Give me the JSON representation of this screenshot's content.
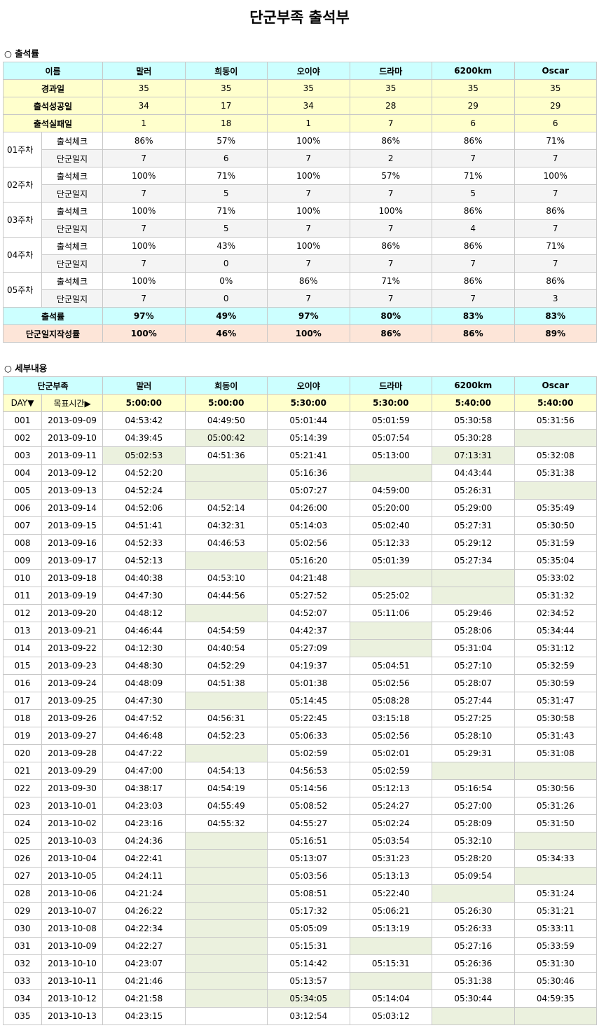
{
  "title": "단군부족 출석부",
  "section1": "○ 출석률",
  "section2": "○ 세부내용",
  "members": [
    "말러",
    "희동이",
    "오이야",
    "드라마",
    "6200km",
    "Oscar"
  ],
  "summary": {
    "header_label": "이름",
    "rows": [
      {
        "label": "경과일",
        "values": [
          "35",
          "35",
          "35",
          "35",
          "35",
          "35"
        ]
      },
      {
        "label": "출석성공일",
        "values": [
          "34",
          "17",
          "34",
          "28",
          "29",
          "29"
        ]
      },
      {
        "label": "출석실패일",
        "values": [
          "1",
          "18",
          "1",
          "7",
          "6",
          "6"
        ]
      }
    ],
    "check_label": "출석체크",
    "log_label": "단군일지",
    "weeks": [
      {
        "label": "01주차",
        "check": [
          "86%",
          "57%",
          "100%",
          "86%",
          "86%",
          "71%"
        ],
        "log": [
          "7",
          "6",
          "7",
          "2",
          "7",
          "7"
        ]
      },
      {
        "label": "02주차",
        "check": [
          "100%",
          "71%",
          "100%",
          "57%",
          "71%",
          "100%"
        ],
        "log": [
          "7",
          "5",
          "7",
          "7",
          "5",
          "7"
        ]
      },
      {
        "label": "03주차",
        "check": [
          "100%",
          "71%",
          "100%",
          "100%",
          "86%",
          "86%"
        ],
        "log": [
          "7",
          "5",
          "7",
          "7",
          "4",
          "7"
        ]
      },
      {
        "label": "04주차",
        "check": [
          "100%",
          "43%",
          "100%",
          "86%",
          "86%",
          "71%"
        ],
        "log": [
          "7",
          "0",
          "7",
          "7",
          "7",
          "7"
        ]
      },
      {
        "label": "05주차",
        "check": [
          "100%",
          "0%",
          "86%",
          "71%",
          "86%",
          "86%"
        ],
        "log": [
          "7",
          "0",
          "7",
          "7",
          "7",
          "3"
        ]
      }
    ],
    "rate": {
      "label": "출석률",
      "values": [
        "97%",
        "49%",
        "97%",
        "80%",
        "83%",
        "83%"
      ]
    },
    "log_rate": {
      "label": "단군일지작성률",
      "values": [
        "100%",
        "46%",
        "100%",
        "86%",
        "86%",
        "89%"
      ]
    }
  },
  "detail": {
    "header_label": "단군부족",
    "day_label": "DAY▼",
    "target_label": "목표시간▶",
    "targets": [
      "5:00:00",
      "5:00:00",
      "5:30:00",
      "5:30:00",
      "5:40:00",
      "5:40:00"
    ],
    "highlight_color": "#ebf1de",
    "rows": [
      {
        "day": "001",
        "date": "2013-09-09",
        "times": [
          "04:53:42",
          "04:49:50",
          "05:01:44",
          "05:01:59",
          "05:30:58",
          "05:31:56"
        ],
        "miss": []
      },
      {
        "day": "002",
        "date": "2013-09-10",
        "times": [
          "04:39:45",
          "05:00:42",
          "05:14:39",
          "05:07:54",
          "05:30:28",
          ""
        ],
        "miss": [
          1,
          5
        ]
      },
      {
        "day": "003",
        "date": "2013-09-11",
        "times": [
          "05:02:53",
          "04:51:36",
          "05:21:41",
          "05:13:00",
          "07:13:31",
          "05:32:08"
        ],
        "miss": [
          0,
          4
        ]
      },
      {
        "day": "004",
        "date": "2013-09-12",
        "times": [
          "04:52:20",
          "",
          "05:16:36",
          "",
          "04:43:44",
          "05:31:38"
        ],
        "miss": [
          1,
          3
        ]
      },
      {
        "day": "005",
        "date": "2013-09-13",
        "times": [
          "04:52:24",
          "",
          "05:07:27",
          "04:59:00",
          "05:26:31",
          ""
        ],
        "miss": [
          1,
          5
        ]
      },
      {
        "day": "006",
        "date": "2013-09-14",
        "times": [
          "04:52:06",
          "04:52:14",
          "04:26:00",
          "05:20:00",
          "05:29:00",
          "05:35:49"
        ],
        "miss": []
      },
      {
        "day": "007",
        "date": "2013-09-15",
        "times": [
          "04:51:41",
          "04:32:31",
          "05:14:03",
          "05:02:40",
          "05:27:31",
          "05:30:50"
        ],
        "miss": []
      },
      {
        "day": "008",
        "date": "2013-09-16",
        "times": [
          "04:52:33",
          "04:46:53",
          "05:02:56",
          "05:12:33",
          "05:29:12",
          "05:31:59"
        ],
        "miss": []
      },
      {
        "day": "009",
        "date": "2013-09-17",
        "times": [
          "04:52:13",
          "",
          "05:16:20",
          "05:01:39",
          "05:27:34",
          "05:35:04"
        ],
        "miss": [
          1
        ]
      },
      {
        "day": "010",
        "date": "2013-09-18",
        "times": [
          "04:40:38",
          "04:53:10",
          "04:21:48",
          "",
          "",
          "05:33:02"
        ],
        "miss": [
          3,
          4
        ]
      },
      {
        "day": "011",
        "date": "2013-09-19",
        "times": [
          "04:47:30",
          "04:44:56",
          "05:27:52",
          "05:25:02",
          "",
          "05:31:32"
        ],
        "miss": [
          4
        ]
      },
      {
        "day": "012",
        "date": "2013-09-20",
        "times": [
          "04:48:12",
          "",
          "04:52:07",
          "05:11:06",
          "05:29:46",
          "02:34:52"
        ],
        "miss": [
          1
        ]
      },
      {
        "day": "013",
        "date": "2013-09-21",
        "times": [
          "04:46:44",
          "04:54:59",
          "04:42:37",
          "",
          "05:28:06",
          "05:34:44"
        ],
        "miss": [
          3
        ]
      },
      {
        "day": "014",
        "date": "2013-09-22",
        "times": [
          "04:12:30",
          "04:40:54",
          "05:27:09",
          "",
          "05:31:04",
          "05:31:12"
        ],
        "miss": [
          3
        ]
      },
      {
        "day": "015",
        "date": "2013-09-23",
        "times": [
          "04:48:30",
          "04:52:29",
          "04:19:37",
          "05:04:51",
          "05:27:10",
          "05:32:59"
        ],
        "miss": []
      },
      {
        "day": "016",
        "date": "2013-09-24",
        "times": [
          "04:48:09",
          "04:51:38",
          "05:01:38",
          "05:02:56",
          "05:28:07",
          "05:30:59"
        ],
        "miss": []
      },
      {
        "day": "017",
        "date": "2013-09-25",
        "times": [
          "04:47:30",
          "",
          "05:14:45",
          "05:08:28",
          "05:27:44",
          "05:31:47"
        ],
        "miss": [
          1
        ]
      },
      {
        "day": "018",
        "date": "2013-09-26",
        "times": [
          "04:47:52",
          "04:56:31",
          "05:22:45",
          "03:15:18",
          "05:27:25",
          "05:30:58"
        ],
        "miss": []
      },
      {
        "day": "019",
        "date": "2013-09-27",
        "times": [
          "04:46:48",
          "04:52:23",
          "05:06:33",
          "05:02:56",
          "05:28:10",
          "05:31:43"
        ],
        "miss": []
      },
      {
        "day": "020",
        "date": "2013-09-28",
        "times": [
          "04:47:22",
          "",
          "05:02:59",
          "05:02:01",
          "05:29:31",
          "05:31:08"
        ],
        "miss": [
          1
        ]
      },
      {
        "day": "021",
        "date": "2013-09-29",
        "times": [
          "04:47:00",
          "04:54:13",
          "04:56:53",
          "05:02:59",
          "",
          ""
        ],
        "miss": [
          4,
          5
        ]
      },
      {
        "day": "022",
        "date": "2013-09-30",
        "times": [
          "04:38:17",
          "04:54:19",
          "05:14:56",
          "05:12:13",
          "05:16:54",
          "05:30:56"
        ],
        "miss": []
      },
      {
        "day": "023",
        "date": "2013-10-01",
        "times": [
          "04:23:03",
          "04:55:49",
          "05:08:52",
          "05:24:27",
          "05:27:00",
          "05:31:26"
        ],
        "miss": []
      },
      {
        "day": "024",
        "date": "2013-10-02",
        "times": [
          "04:23:16",
          "04:55:32",
          "04:55:27",
          "05:02:24",
          "05:28:09",
          "05:31:50"
        ],
        "miss": []
      },
      {
        "day": "025",
        "date": "2013-10-03",
        "times": [
          "04:24:36",
          "",
          "05:16:51",
          "05:03:54",
          "05:32:10",
          ""
        ],
        "miss": [
          1,
          5
        ]
      },
      {
        "day": "026",
        "date": "2013-10-04",
        "times": [
          "04:22:41",
          "",
          "05:13:07",
          "05:31:23",
          "05:28:20",
          "05:34:33"
        ],
        "miss": [
          1
        ]
      },
      {
        "day": "027",
        "date": "2013-10-05",
        "times": [
          "04:24:11",
          "",
          "05:03:56",
          "05:13:13",
          "05:09:54",
          ""
        ],
        "miss": [
          1,
          5
        ]
      },
      {
        "day": "028",
        "date": "2013-10-06",
        "times": [
          "04:21:24",
          "",
          "05:08:51",
          "05:22:40",
          "",
          "05:31:24"
        ],
        "miss": [
          1,
          4
        ]
      },
      {
        "day": "029",
        "date": "2013-10-07",
        "times": [
          "04:26:22",
          "",
          "05:17:32",
          "05:06:21",
          "05:26:30",
          "05:31:21"
        ],
        "miss": [
          1
        ]
      },
      {
        "day": "030",
        "date": "2013-10-08",
        "times": [
          "04:22:34",
          "",
          "05:05:09",
          "05:13:19",
          "05:26:33",
          "05:33:11"
        ],
        "miss": [
          1
        ]
      },
      {
        "day": "031",
        "date": "2013-10-09",
        "times": [
          "04:22:27",
          "",
          "05:15:31",
          "",
          "05:27:16",
          "05:33:59"
        ],
        "miss": [
          1,
          3
        ]
      },
      {
        "day": "032",
        "date": "2013-10-10",
        "times": [
          "04:23:07",
          "",
          "05:14:42",
          "05:15:31",
          "05:26:36",
          "05:31:30"
        ],
        "miss": [
          1
        ]
      },
      {
        "day": "033",
        "date": "2013-10-11",
        "times": [
          "04:21:46",
          "",
          "05:13:57",
          "",
          "05:31:38",
          "05:30:46"
        ],
        "miss": [
          1,
          3
        ]
      },
      {
        "day": "034",
        "date": "2013-10-12",
        "times": [
          "04:21:58",
          "",
          "05:34:05",
          "05:14:04",
          "05:30:44",
          "04:59:35"
        ],
        "miss": [
          1,
          2
        ]
      },
      {
        "day": "035",
        "date": "2013-10-13",
        "times": [
          "04:23:15",
          "",
          "03:12:54",
          "05:03:12",
          "",
          ""
        ],
        "miss": [
          4,
          5
        ]
      }
    ]
  }
}
